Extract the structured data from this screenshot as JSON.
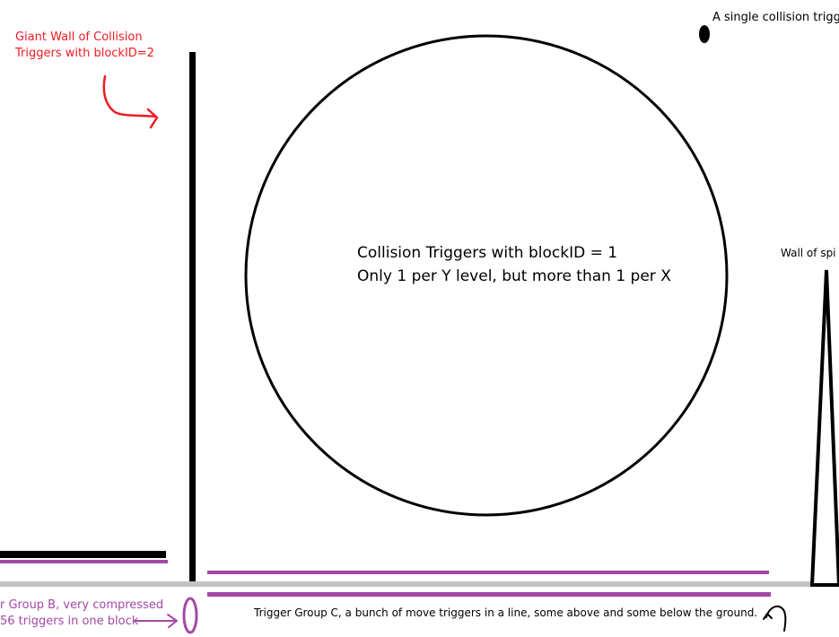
{
  "labels": {
    "giant_wall_line1": "Giant Wall of Collision",
    "giant_wall_line2": "Triggers with blockID=2",
    "single_trigger": "A single collision trigge",
    "circle_line1": "Collision Triggers with blockID = 1",
    "circle_line2": "Only 1 per Y level, but more than 1 per X",
    "spikes": "Wall of spi",
    "group_b_line1": "r Group B, very compressed",
    "group_b_line2": "56 triggers in one block",
    "group_c": "Trigger Group C, a bunch of move triggers in a line, some above and some below the ground."
  },
  "colors": {
    "red_annotation": "#ed1c24",
    "purple_triggers": "#a349a4",
    "ground": "#c3c3c3",
    "ink": "#000000"
  }
}
